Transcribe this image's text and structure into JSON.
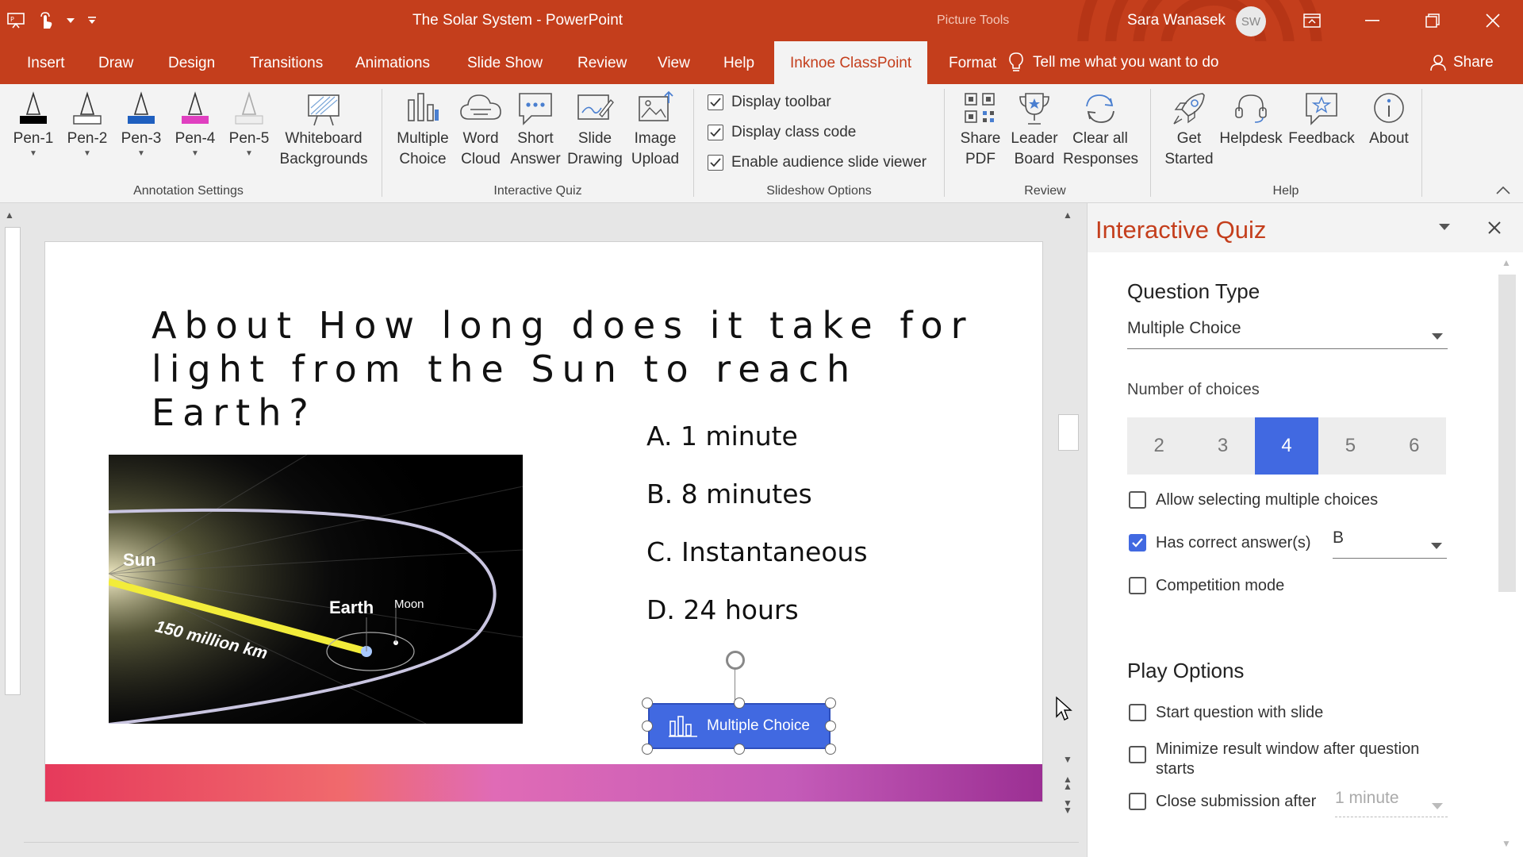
{
  "window": {
    "title": "The Solar System  -  PowerPoint",
    "context_tab_group": "Picture Tools",
    "user_name": "Sara Wanasek",
    "user_initials": "SW"
  },
  "tabs": [
    {
      "label": "Insert"
    },
    {
      "label": "Draw"
    },
    {
      "label": "Design"
    },
    {
      "label": "Transitions"
    },
    {
      "label": "Animations"
    },
    {
      "label": "Slide Show"
    },
    {
      "label": "Review"
    },
    {
      "label": "View"
    },
    {
      "label": "Help"
    },
    {
      "label": "Inknoe ClassPoint",
      "active": true
    },
    {
      "label": "Format"
    }
  ],
  "tell_me": "Tell me what you want to do",
  "share_label": "Share",
  "ribbon": {
    "annotation": {
      "group_label": "Annotation Settings",
      "pens": [
        {
          "label": "Pen-1",
          "color": "#000000"
        },
        {
          "label": "Pen-2",
          "color": "#ffffff"
        },
        {
          "label": "Pen-3",
          "color": "#1f5fbf"
        },
        {
          "label": "Pen-4",
          "color": "#e040c0"
        },
        {
          "label": "Pen-5",
          "color": "#eeeeee"
        }
      ],
      "whiteboard_line1": "Whiteboard",
      "whiteboard_line2": "Backgrounds"
    },
    "quiz": {
      "group_label": "Interactive Quiz",
      "buttons": [
        {
          "line1": "Multiple",
          "line2": "Choice",
          "icon": "bar-chart-icon"
        },
        {
          "line1": "Word",
          "line2": "Cloud",
          "icon": "cloud-icon"
        },
        {
          "line1": "Short",
          "line2": "Answer",
          "icon": "speech-bubble-icon"
        },
        {
          "line1": "Slide",
          "line2": "Drawing",
          "icon": "pen-drawing-icon"
        },
        {
          "line1": "Image",
          "line2": "Upload",
          "icon": "image-upload-icon"
        }
      ]
    },
    "slideshow": {
      "group_label": "Slideshow Options",
      "options": [
        {
          "label": "Display toolbar",
          "checked": true
        },
        {
          "label": "Display class code",
          "checked": true
        },
        {
          "label": "Enable audience slide viewer",
          "checked": true
        }
      ]
    },
    "review": {
      "group_label": "Review",
      "buttons": [
        {
          "line1": "Share",
          "line2": "PDF",
          "icon": "qr-code-icon"
        },
        {
          "line1": "Leader",
          "line2": "Board",
          "icon": "trophy-icon"
        },
        {
          "line1": "Clear all",
          "line2": "Responses",
          "icon": "refresh-icon"
        }
      ]
    },
    "help": {
      "group_label": "Help",
      "buttons": [
        {
          "line1": "Get",
          "line2": "Started",
          "icon": "rocket-icon"
        },
        {
          "line1": "Helpdesk",
          "line2": "",
          "icon": "headset-icon"
        },
        {
          "line1": "Feedback",
          "line2": "",
          "icon": "feedback-star-icon"
        },
        {
          "line1": "About",
          "line2": "",
          "icon": "info-icon"
        }
      ]
    }
  },
  "slide": {
    "title": "About How long does it take for light from the Sun to reach Earth?",
    "image_labels": {
      "sun": "Sun",
      "distance": "150 million km",
      "earth": "Earth",
      "moon": "Moon"
    },
    "choices": [
      "A. 1 minute",
      "B. 8 minutes",
      "C. Instantaneous",
      "D. 24 hours"
    ],
    "quiz_button_label": "Multiple Choice"
  },
  "pane": {
    "title": "Interactive Quiz",
    "question_type_heading": "Question Type",
    "question_type_value": "Multiple Choice",
    "num_choices_label": "Number of choices",
    "num_choices_options": [
      "2",
      "3",
      "4",
      "5",
      "6"
    ],
    "num_choices_selected": "4",
    "allow_multiple_label": "Allow selecting multiple choices",
    "allow_multiple_checked": false,
    "has_correct_label": "Has correct answer(s)",
    "has_correct_checked": true,
    "correct_answer_value": "B",
    "competition_label": "Competition mode",
    "competition_checked": false,
    "play_options_heading": "Play Options",
    "start_with_slide_label": "Start question with slide",
    "minimize_label": "Minimize result window after question starts",
    "close_submission_label": "Close submission after",
    "close_submission_value": "1 minute"
  },
  "colors": {
    "accent": "#c43e1c",
    "quiz_blue": "#4169e1"
  }
}
